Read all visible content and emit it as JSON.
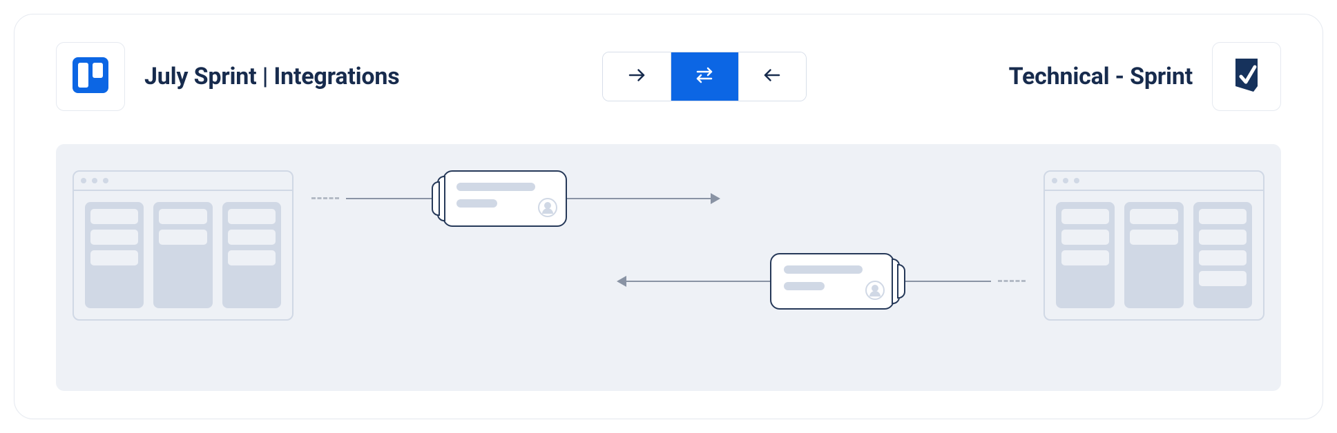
{
  "left_board_title": "July Sprint | Integrations",
  "right_board_title": "Technical - Sprint",
  "icons": {
    "left_app": "trello-icon",
    "right_app": "smartsheet-icon",
    "dir_right": "arrow-right-icon",
    "dir_both": "swap-icon",
    "dir_left": "arrow-left-icon"
  },
  "direction": {
    "options": [
      "right",
      "both",
      "left"
    ],
    "selected": "both"
  }
}
